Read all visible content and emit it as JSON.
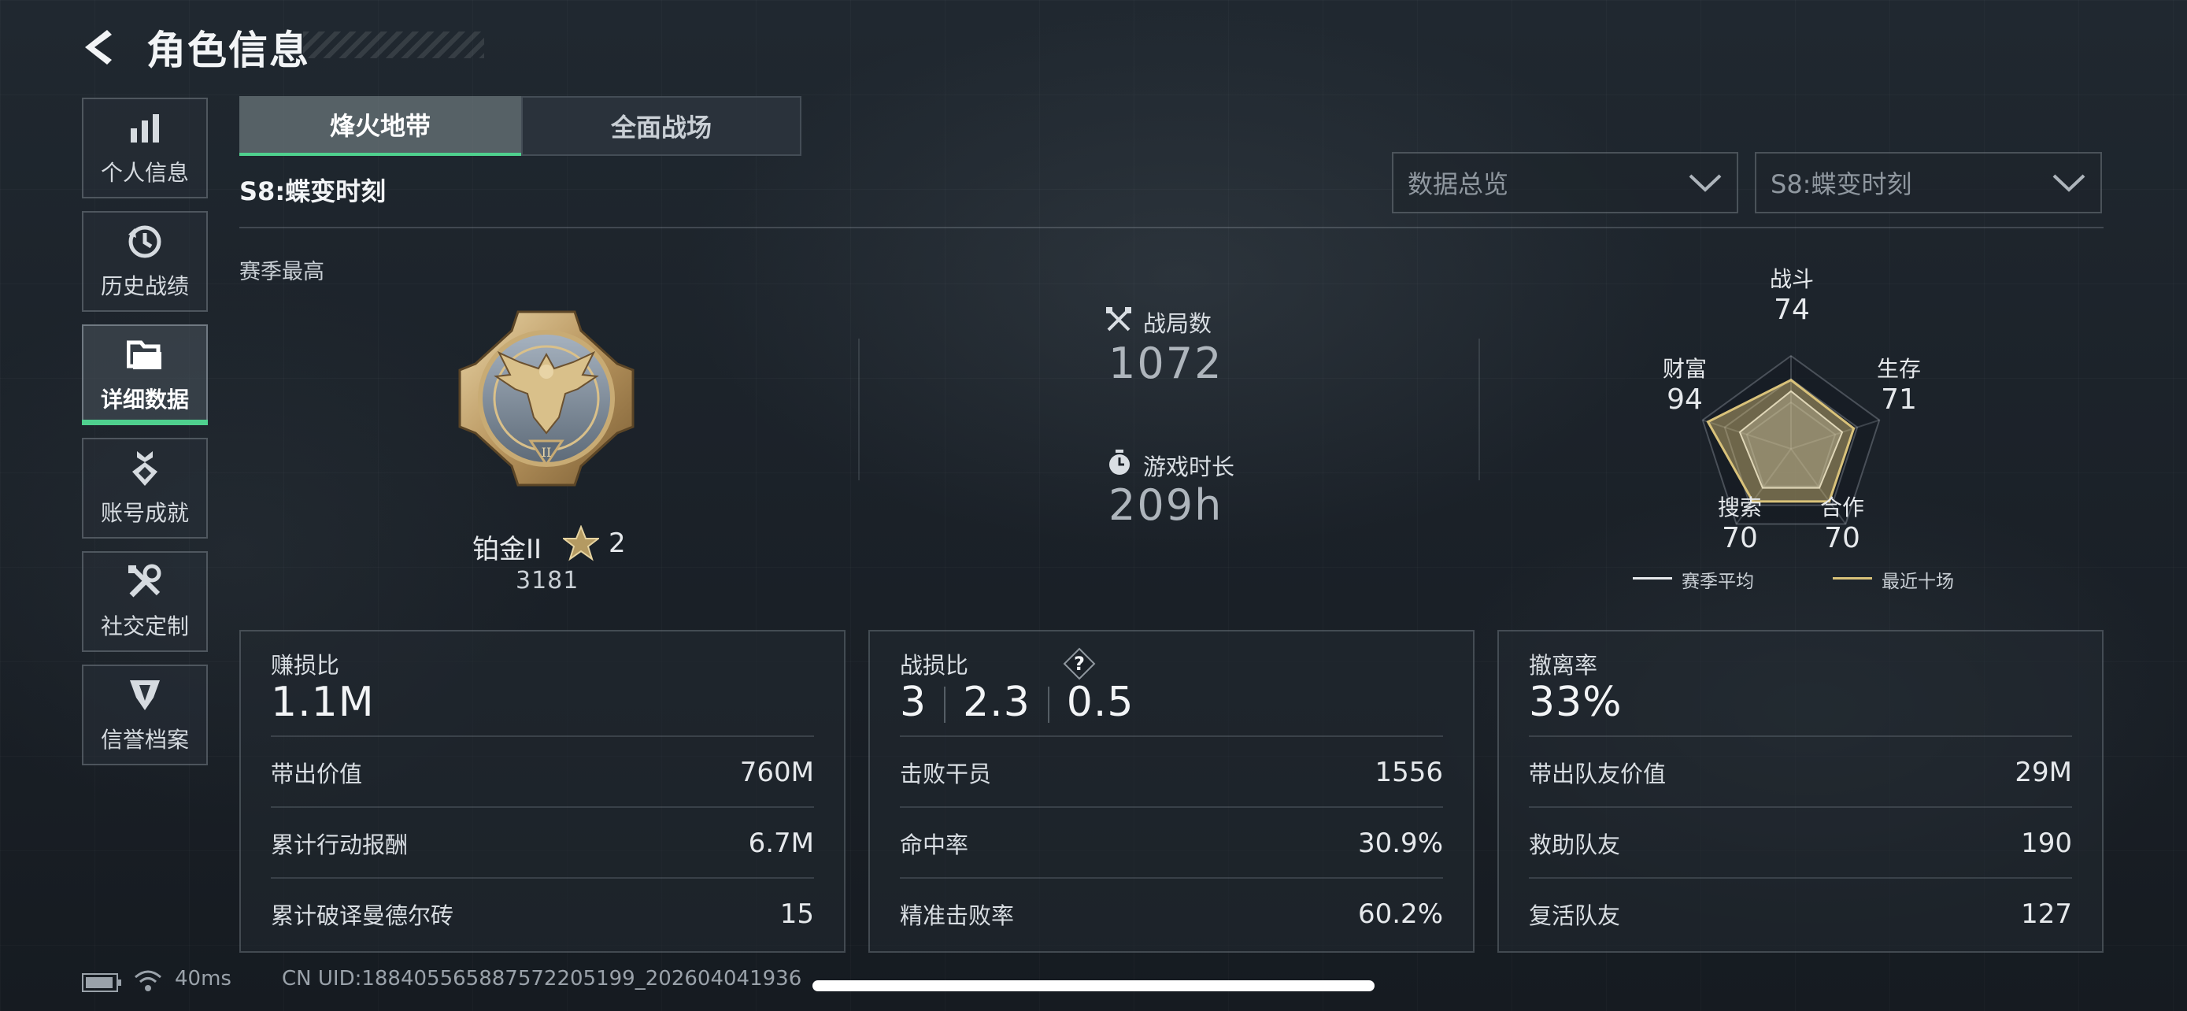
{
  "header": {
    "title": "角色信息"
  },
  "sidebar": {
    "items": [
      {
        "label": "个人信息",
        "icon": "bar-chart-icon"
      },
      {
        "label": "历史战绩",
        "icon": "history-clock-icon"
      },
      {
        "label": "详细数据",
        "icon": "folder-icon",
        "active": true
      },
      {
        "label": "账号成就",
        "icon": "medal-icon"
      },
      {
        "label": "社交定制",
        "icon": "tools-icon"
      },
      {
        "label": "信誉档案",
        "icon": "shield-badge-icon"
      }
    ]
  },
  "tabs": [
    {
      "label": "烽火地带",
      "active": true
    },
    {
      "label": "全面战场",
      "active": false
    }
  ],
  "season": {
    "label": "S8:蝶变时刻"
  },
  "filters": {
    "data_type": "数据总览",
    "season": "S8:蝶变时刻"
  },
  "overview": {
    "section_label": "赛季最高",
    "rank_name": "铂金II",
    "rank_stars": "2",
    "rank_score": "3181",
    "matches_label": "战局数",
    "matches_value": "1072",
    "playtime_label": "游戏时长",
    "playtime_value": "209h"
  },
  "radar": {
    "axes": [
      {
        "label": "战斗",
        "value": "74"
      },
      {
        "label": "生存",
        "value": "71"
      },
      {
        "label": "合作",
        "value": "70"
      },
      {
        "label": "搜索",
        "value": "70"
      },
      {
        "label": "财富",
        "value": "94"
      }
    ],
    "season_avg": [
      0.62,
      0.58,
      0.52,
      0.52,
      0.58
    ],
    "recent_ten": [
      0.74,
      0.71,
      0.7,
      0.7,
      0.94
    ],
    "legend": {
      "season_avg": "赛季平均",
      "recent_ten": "最近十场"
    },
    "colors": {
      "season_avg": "#e6e9ec",
      "recent_ten": "#d9c27a"
    }
  },
  "cards": [
    {
      "title": "赚损比",
      "big": "1.1M",
      "rows": [
        {
          "label": "带出价值",
          "value": "760M"
        },
        {
          "label": "累计行动报酬",
          "value": "6.7M"
        },
        {
          "label": "累计破译曼德尔砖",
          "value": "15"
        }
      ]
    },
    {
      "title": "战损比",
      "kd": [
        "3",
        "2.3",
        "0.5"
      ],
      "rows": [
        {
          "label": "击败干员",
          "value": "1556"
        },
        {
          "label": "命中率",
          "value": "30.9%"
        },
        {
          "label": "精准击败率",
          "value": "60.2%"
        }
      ]
    },
    {
      "title": "撤离率",
      "big": "33%",
      "rows": [
        {
          "label": "带出队友价值",
          "value": "29M"
        },
        {
          "label": "救助队友",
          "value": "190"
        },
        {
          "label": "复活队友",
          "value": "127"
        }
      ]
    }
  ],
  "status": {
    "ping": "40ms",
    "uid": "CN UID:1884055658875722051​99_202604041936"
  },
  "colors": {
    "accent": "#4fd08e",
    "background": "#1b2128"
  }
}
